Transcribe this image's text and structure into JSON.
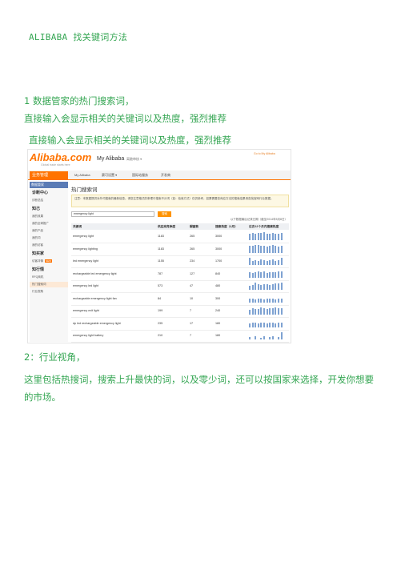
{
  "title": "ALIBABA 找关键词方法",
  "section1_heading": "1 数据管家的热门搜索词，",
  "section1_line1": "直接输入会显示相关的关键词以及热度，强烈推荐",
  "section1_line2": "直接输入会显示相关的关键词以及热度，强烈推荐",
  "section2_heading": "2：行业视角，",
  "section2_paragraph": "这里包括热搜词，搜索上升最快的词，以及零少词，还可以按国家来选择，开发你想要的市场。",
  "screenshot": {
    "logo": "Alibaba.com",
    "logo_sub": "Global trade starts here",
    "my_alibaba": "My Alibaba",
    "account": "离散审核 ▾",
    "top_right": "Go to My Alibaba",
    "nav": [
      "业务管理",
      "My Alibaba",
      "赛可设置 ▾",
      "国际站服务",
      "开发商"
    ],
    "sidebar": {
      "title": "数据管家",
      "items": [
        {
          "type": "section",
          "label": "诊断中心"
        },
        {
          "type": "item",
          "label": "诊断总结"
        },
        {
          "type": "section",
          "label": "知己"
        },
        {
          "type": "item",
          "label": "我的效果"
        },
        {
          "type": "item",
          "label": "我的全球推广"
        },
        {
          "type": "item",
          "label": "我的产品"
        },
        {
          "type": "item",
          "label": "我的词"
        },
        {
          "type": "item",
          "label": "我的访客"
        },
        {
          "type": "section",
          "label": "知买家"
        },
        {
          "type": "item",
          "label": "访客详情",
          "badge": "NEW"
        },
        {
          "type": "section",
          "label": "知行情"
        },
        {
          "type": "item",
          "label": "RFQ商机"
        },
        {
          "type": "item",
          "label": "热门搜索词",
          "active": true
        },
        {
          "type": "item",
          "label": "行业视角"
        }
      ]
    },
    "main_title": "热门搜索词",
    "notice": "注意：本数据提供对外词搜索的最新信息。请您注意格式的条理中搜索不分词（如：检索方式）仅供参考，如果需要查询应方法的搜索结果请查找官网行业数据。",
    "search_value": "emergency light",
    "search_button": "搜索",
    "note": "以下数据最后记录日期（截至2014年5月8日）",
    "columns": [
      "关键词",
      "供应商竞争度",
      "橱窗数",
      "搜索热度（4月）",
      "过去12个月内搜索热度"
    ],
    "rows": [
      {
        "keyword": "emergency light",
        "competition": "1183",
        "showcase": "265",
        "popularity": "3000",
        "trend": [
          0.8,
          0.9,
          0.85,
          0.95,
          0.9,
          1.0,
          0.85,
          0.8,
          0.9,
          0.85,
          0.8,
          0.9
        ]
      },
      {
        "keyword": "emergency lighting",
        "competition": "1183",
        "showcase": "265",
        "popularity": "3000",
        "trend": [
          0.9,
          0.85,
          0.95,
          1.0,
          0.9,
          0.85,
          0.8,
          0.9,
          0.95,
          0.85,
          0.8,
          0.85
        ]
      },
      {
        "keyword": "led emergency light",
        "competition": "1155",
        "showcase": "234",
        "popularity": "1700",
        "trend": [
          0.9,
          0.5,
          0.6,
          0.55,
          0.7,
          0.6,
          0.5,
          0.6,
          0.7,
          0.55,
          0.6,
          0.95
        ]
      },
      {
        "keyword": "rechargeable led emergency light",
        "competition": "787",
        "showcase": "127",
        "popularity": "840",
        "trend": [
          0.7,
          0.6,
          0.65,
          0.8,
          0.7,
          0.75,
          0.6,
          0.7,
          0.65,
          0.7,
          0.75,
          0.8
        ]
      },
      {
        "keyword": "emergency led light",
        "competition": "573",
        "showcase": "47",
        "popularity": "480",
        "trend": [
          0.5,
          0.6,
          0.9,
          0.7,
          0.6,
          0.7,
          0.75,
          0.65,
          0.7,
          0.8,
          0.85,
          0.9
        ]
      },
      {
        "keyword": "rechargeable emergency light fan",
        "competition": "84",
        "showcase": "10",
        "popularity": "300",
        "trend": [
          0.5,
          0.45,
          0.4,
          0.5,
          0.45,
          0.4,
          0.45,
          0.5,
          0.45,
          0.4,
          0.45,
          0.5
        ]
      },
      {
        "keyword": "emergency exit light",
        "competition": "199",
        "showcase": "7",
        "popularity": "240",
        "trend": [
          0.6,
          0.8,
          0.7,
          0.75,
          0.9,
          0.8,
          0.75,
          0.85,
          0.8,
          0.9,
          0.85,
          0.8
        ]
      },
      {
        "keyword": "dp led rechargeable emergency light",
        "competition": "235",
        "showcase": "17",
        "popularity": "180",
        "trend": [
          0.5,
          0.6,
          0.55,
          0.5,
          0.6,
          0.55,
          0.5,
          0.6,
          0.55,
          0.5,
          0.6,
          0.55
        ]
      },
      {
        "keyword": "emergency light battery",
        "competition": "210",
        "showcase": "7",
        "popularity": "180",
        "trend": [
          0.3,
          0.0,
          0.4,
          0.0,
          0.2,
          0.4,
          0.0,
          0.3,
          0.4,
          0.0,
          0.3,
          0.9
        ]
      }
    ]
  }
}
